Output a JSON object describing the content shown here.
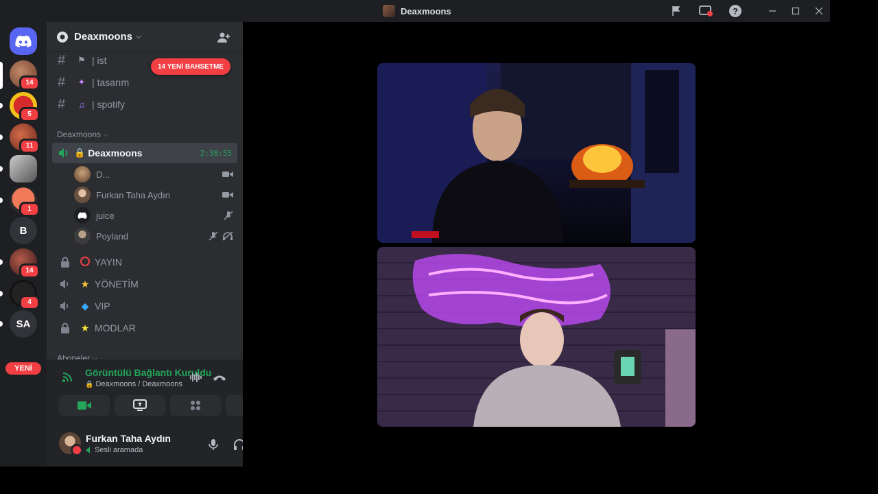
{
  "window": {
    "title": "Deaxmoons"
  },
  "rail": {
    "servers": [
      {
        "badge": "14",
        "initials": ""
      },
      {
        "badge": "5",
        "initials": ""
      },
      {
        "badge": "11",
        "initials": ""
      },
      {
        "badge": "",
        "initials": ""
      },
      {
        "badge": "1",
        "initials": ""
      },
      {
        "badge": "",
        "initials": "B"
      },
      {
        "badge": "14",
        "initials": ""
      },
      {
        "badge": "4",
        "initials": ""
      },
      {
        "badge": "",
        "initials": "SA"
      }
    ],
    "new_label": "YENİ"
  },
  "sidebar": {
    "server_name": "Deaxmoons",
    "mention_pill": "14 YENİ BAHSETME",
    "text_channels": [
      {
        "name": "| ist"
      },
      {
        "name": "| tasarım"
      },
      {
        "name": "| spotify"
      }
    ],
    "category_voice": "Deaxmoons",
    "active_voice": {
      "name": "Deaxmoons",
      "timer": "2:38:55"
    },
    "members": [
      {
        "name": "D..."
      },
      {
        "name": "Furkan Taha Aydın"
      },
      {
        "name": "juice"
      },
      {
        "name": "Poyland"
      }
    ],
    "more_channels": [
      {
        "name": "YAYIN"
      },
      {
        "name": "YÖNETİM"
      },
      {
        "name": "VIP"
      },
      {
        "name": "MODLAR"
      }
    ],
    "category_next": "Aboneler"
  },
  "voice_panel": {
    "status": "Görüntülü Bağlantı Kuruldu",
    "location": "Deaxmoons / Deaxmoons"
  },
  "user": {
    "name": "Furkan Taha Aydın",
    "status": "Sesli aramada"
  },
  "colors": {
    "accent_green": "#23a55a",
    "danger_red": "#f23f43",
    "sidebar_bg": "#2b2d31",
    "rail_bg": "#1e1f22"
  }
}
